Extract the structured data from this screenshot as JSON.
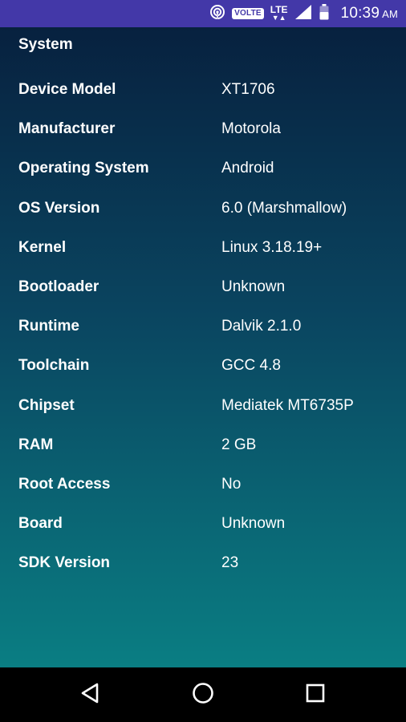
{
  "status_bar": {
    "volte": "VOLTE",
    "network": "LTE",
    "time": "10:39",
    "ampm": "AM"
  },
  "section": {
    "title": "System"
  },
  "rows": [
    {
      "label": "Device Model",
      "value": "XT1706"
    },
    {
      "label": "Manufacturer",
      "value": "Motorola"
    },
    {
      "label": "Operating System",
      "value": "Android"
    },
    {
      "label": "OS Version",
      "value": "6.0 (Marshmallow)"
    },
    {
      "label": "Kernel",
      "value": "Linux 3.18.19+"
    },
    {
      "label": "Bootloader",
      "value": "Unknown"
    },
    {
      "label": "Runtime",
      "value": "Dalvik 2.1.0"
    },
    {
      "label": "Toolchain",
      "value": "GCC 4.8"
    },
    {
      "label": "Chipset",
      "value": "Mediatek MT6735P"
    },
    {
      "label": "RAM",
      "value": "2 GB"
    },
    {
      "label": "Root Access",
      "value": "No"
    },
    {
      "label": "Board",
      "value": "Unknown"
    },
    {
      "label": "SDK Version",
      "value": "23"
    }
  ],
  "icons": {
    "hotspot": "hotspot-icon",
    "signal": "signal-icon",
    "battery": "battery-icon",
    "back": "back-icon",
    "home": "home-icon",
    "recents": "recents-icon"
  },
  "colors": {
    "status_bar": "#4338a8",
    "gradient_top": "#07213f",
    "gradient_bottom": "#0a7e83",
    "nav_bar": "#000000"
  }
}
